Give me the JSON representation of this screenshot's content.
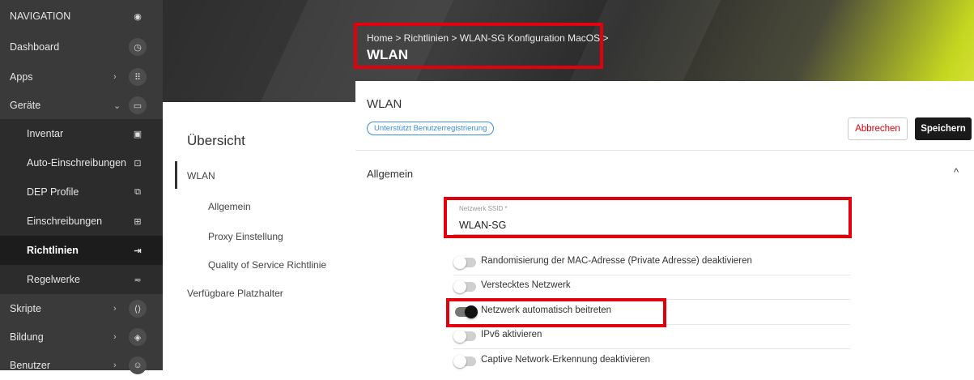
{
  "sidebar": {
    "heading": "NAVIGATION",
    "heading_icon": "radio-dot-icon",
    "items": [
      {
        "label": "Dashboard",
        "icon": "dashboard-icon",
        "chevron": "",
        "glyph": "◷"
      },
      {
        "label": "Apps",
        "icon": "apps-grid-icon",
        "chevron": "›",
        "glyph": "⠿"
      },
      {
        "label": "Geräte",
        "icon": "devices-icon",
        "chevron": "⌄",
        "glyph": "▭"
      },
      {
        "label": "Inventar",
        "icon": "inventory-icon",
        "chevron": "",
        "glyph": "▣"
      },
      {
        "label": "Auto-Einschreibungen",
        "icon": "auto-enroll-icon",
        "chevron": "",
        "glyph": "⊡"
      },
      {
        "label": "DEP Profile",
        "icon": "dep-profile-icon",
        "chevron": "",
        "glyph": "⧉"
      },
      {
        "label": "Einschreibungen",
        "icon": "enrollment-icon",
        "chevron": "",
        "glyph": "⊞"
      },
      {
        "label": "Richtlinien",
        "icon": "policy-icon",
        "chevron": "",
        "glyph": "⇥"
      },
      {
        "label": "Regelwerke",
        "icon": "ruleset-icon",
        "chevron": "",
        "glyph": "≂"
      },
      {
        "label": "Skripte",
        "icon": "scripts-icon",
        "chevron": "›",
        "glyph": "⟨⟩"
      },
      {
        "label": "Bildung",
        "icon": "education-icon",
        "chevron": "›",
        "glyph": "◈"
      },
      {
        "label": "Benutzer",
        "icon": "users-icon",
        "chevron": "›",
        "glyph": "☺"
      }
    ]
  },
  "breadcrumb": {
    "path": "Home > Richtlinien > WLAN-SG Konfiguration MacOS >",
    "title": "WLAN"
  },
  "overview": {
    "title": "Übersicht",
    "items": [
      "WLAN",
      "Allgemein",
      "Proxy Einstellung",
      "Quality of Service Richtlinie",
      "Verfügbare Platzhalter"
    ]
  },
  "main": {
    "title": "WLAN",
    "badge": "Unterstützt Benutzerregistrierung",
    "cancel_label": "Abbrechen",
    "save_label": "Speichern",
    "section_title": "Allgemein",
    "section_chevron": "^"
  },
  "ssid": {
    "label": "Netzwerk SSID *",
    "value": "WLAN-SG"
  },
  "toggles": [
    {
      "label": "Randomisierung der MAC-Adresse (Private Adresse) deaktivieren",
      "on": false
    },
    {
      "label": "Verstecktes Netzwerk",
      "on": false
    },
    {
      "label": "Netzwerk automatisch beitreten",
      "on": true
    },
    {
      "label": "IPv6 aktivieren",
      "on": false
    },
    {
      "label": "Captive Network-Erkennung deaktivieren",
      "on": false
    }
  ],
  "colors": {
    "accent_red": "#e2000f",
    "badge_blue": "#3a8fd8",
    "header_lime": "#c5d620"
  }
}
